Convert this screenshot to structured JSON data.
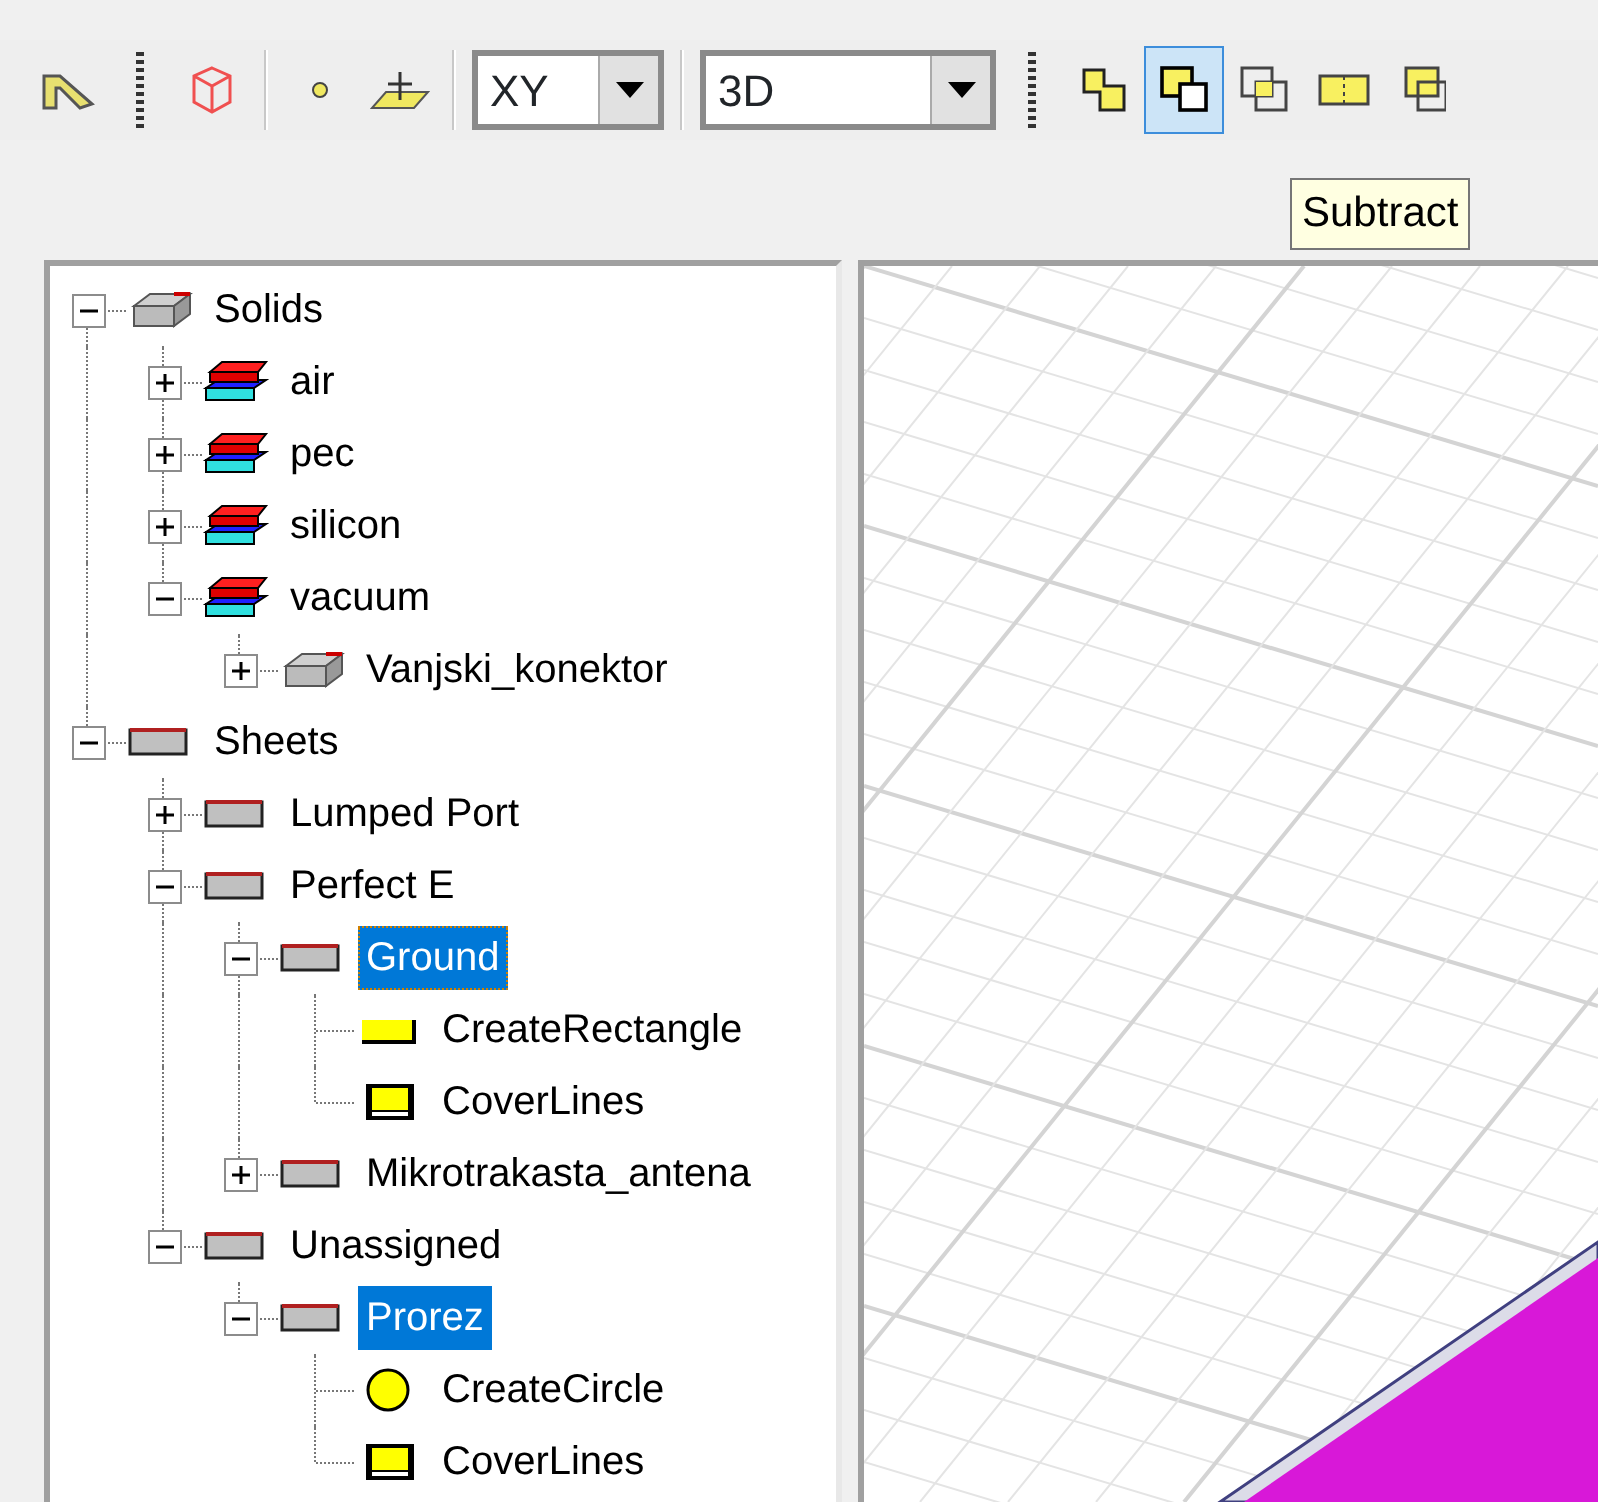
{
  "toolbar": [
    {
      "kind": "button",
      "selected": false
    },
    {
      "kind": "grip"
    },
    {
      "kind": "button",
      "selected": false
    },
    {
      "kind": "separator"
    },
    {
      "kind": "button",
      "selected": false
    },
    {
      "kind": "button",
      "selected": false
    },
    {
      "kind": "separator"
    },
    {
      "kind": "dropdown",
      "value": "XY"
    },
    {
      "kind": "separator"
    },
    {
      "kind": "dropdown",
      "value": "3D"
    },
    {
      "kind": "grip"
    },
    {
      "kind": "button",
      "selected": false
    },
    {
      "kind": "button",
      "selected": true
    },
    {
      "kind": "button",
      "selected": false
    },
    {
      "kind": "button",
      "selected": false
    },
    {
      "kind": "button",
      "selected": false
    }
  ],
  "tooltip": "Subtract",
  "tree": [
    {
      "label": "Solids",
      "kind": "solid",
      "expanded": true,
      "selected": false,
      "children": [
        {
          "label": "air",
          "kind": "material",
          "expanded": false,
          "selected": false
        },
        {
          "label": "pec",
          "kind": "material",
          "expanded": false,
          "selected": false
        },
        {
          "label": "silicon",
          "kind": "material",
          "expanded": false,
          "selected": false
        },
        {
          "label": "vacuum",
          "kind": "material",
          "expanded": true,
          "selected": false,
          "children": [
            {
              "label": "Vanjski_konektor",
              "kind": "solid",
              "expanded": false,
              "selected": false
            }
          ]
        }
      ]
    },
    {
      "label": "Sheets",
      "kind": "sheet",
      "expanded": true,
      "selected": false,
      "children": [
        {
          "label": "Lumped Port",
          "kind": "sheet",
          "expanded": false,
          "selected": false
        },
        {
          "label": "Perfect E",
          "kind": "sheet",
          "expanded": true,
          "selected": false,
          "children": [
            {
              "label": "Ground",
              "kind": "sheet",
              "expanded": true,
              "selected": true,
              "focused": true,
              "children": [
                {
                  "label": "CreateRectangle",
                  "kind": "rectangle",
                  "selected": false
                },
                {
                  "label": "CoverLines",
                  "kind": "cover",
                  "selected": false
                }
              ]
            },
            {
              "label": "Mikrotrakasta_antena",
              "kind": "sheet",
              "expanded": false,
              "selected": false
            }
          ]
        },
        {
          "label": "Unassigned",
          "kind": "sheet",
          "expanded": true,
          "selected": false,
          "children": [
            {
              "label": "Prorez",
              "kind": "sheet",
              "expanded": true,
              "selected": true,
              "focused": false,
              "children": [
                {
                  "label": "CreateCircle",
                  "kind": "circle",
                  "selected": false
                },
                {
                  "label": "CoverLines",
                  "kind": "cover",
                  "selected": false
                }
              ]
            }
          ]
        }
      ]
    }
  ]
}
